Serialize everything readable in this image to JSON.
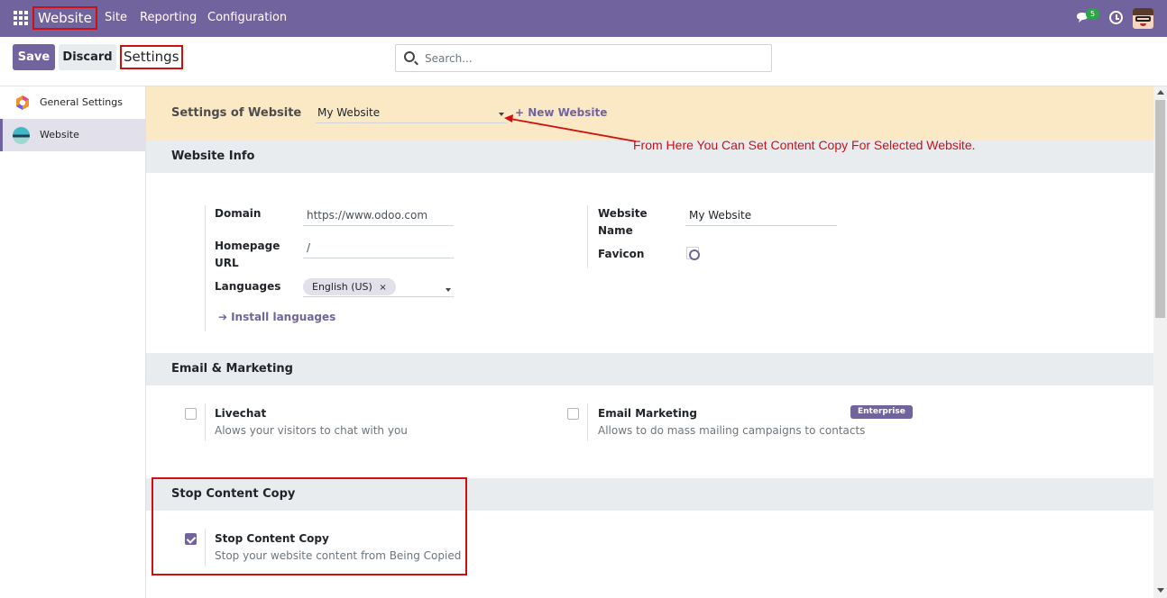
{
  "navbar": {
    "app_name": "Website",
    "menu": [
      "Site",
      "Reporting",
      "Configuration"
    ],
    "chat_count": "5",
    "icons": [
      "apps-icon",
      "chat-icon",
      "clock-icon",
      "avatar"
    ],
    "color": "#71639e"
  },
  "control_panel": {
    "save_label": "Save",
    "discard_label": "Discard",
    "title": "Settings",
    "search_placeholder": "Search..."
  },
  "sidebar": {
    "items": [
      {
        "label": "General Settings",
        "icon": "general-settings-icon",
        "active": false
      },
      {
        "label": "Website",
        "icon": "website-icon",
        "active": true
      }
    ]
  },
  "website_bar": {
    "label": "Settings of Website",
    "selected": "My Website",
    "new_label": "+ New Website"
  },
  "annotation": {
    "text": "From Here You Can Set Content Copy For Selected Website.",
    "color": "#d01010"
  },
  "website_info": {
    "title": "Website Info",
    "domain_label": "Domain",
    "domain_placeholder": "https://www.odoo.com",
    "homepage_label": "Homepage URL",
    "homepage_value": "/",
    "languages_label": "Languages",
    "language_tag": "English (US)",
    "install_label": "Install languages",
    "website_name_label": "Website Name",
    "website_name_value": "My Website",
    "favicon_label": "Favicon"
  },
  "email_marketing": {
    "title": "Email & Marketing",
    "livechat_title": "Livechat",
    "livechat_desc": "Alows your visitors to chat with you",
    "livechat_checked": false,
    "email_title": "Email Marketing",
    "email_desc": "Allows to do mass mailing campaigns to contacts",
    "email_badge": "Enterprise",
    "email_checked": false
  },
  "stop_content_copy": {
    "title": "Stop Content Copy",
    "option_title": "Stop Content Copy",
    "option_desc": "Stop your website content from Being Copied",
    "checked": true
  }
}
